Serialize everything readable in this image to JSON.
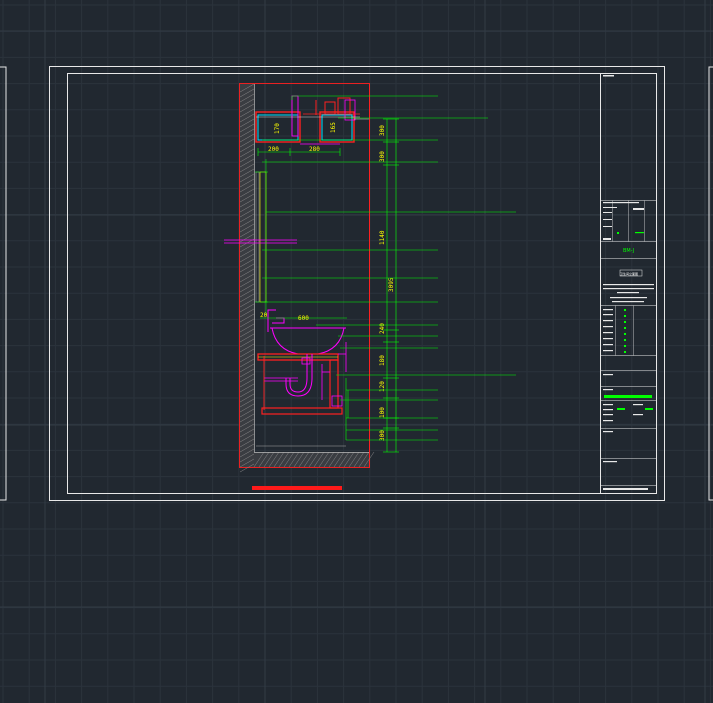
{
  "colors": {
    "background": "#212830",
    "grid_minor": "#2b333c",
    "grid_major": "#323b45",
    "sheet_line": "#e8e8e8",
    "wall_red": "#ff2020",
    "leader_green": "#00ff00",
    "dimension_yellow": "#ffff00",
    "fixture_magenta": "#ff00ff",
    "tile_cyan": "#00e0ff",
    "hatch_gray": "#8a8a8a",
    "scale_bar_red": "#ff1a1a"
  },
  "drawing": {
    "horizontal_dims": [
      "200",
      "280"
    ],
    "small_dims": [
      "170",
      "165"
    ],
    "vertical_dims": [
      "300",
      "300",
      "1140",
      "3095",
      "240",
      "180",
      "120",
      "100",
      "300"
    ],
    "basin_dims": [
      "20",
      "600"
    ]
  },
  "title_block": {
    "green_label": "BM-J",
    "heading": "卫生间立面图"
  }
}
